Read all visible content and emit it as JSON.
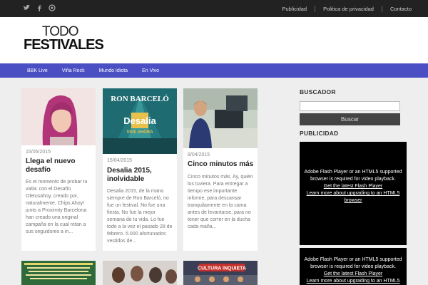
{
  "topbar": {
    "social_icons": [
      "twitter-icon",
      "facebook-icon",
      "globe-icon"
    ],
    "links": [
      "Publicidad",
      "Politica de privacidad",
      "Contacto"
    ]
  },
  "logo": {
    "line1": "TODO",
    "line2": "FESTIVALES"
  },
  "nav": {
    "items": [
      "BBK Live",
      "Viña Rock",
      "Mundo Idiota",
      "En Vivo"
    ]
  },
  "posts": [
    {
      "date": "15/05/2015",
      "title": "Llega el nuevo desafío",
      "excerpt": "Es el momento de probar tu valía: con el Desafío Oletusahoy, creado por, naturalmente, Chips Ahoy! junto a Proximity Barcelona han creado una original campaña en la cual retan a sus seguidores a in..."
    },
    {
      "date": "15/04/2015",
      "title": "Desalia 2015, inolvidable",
      "image_text": [
        "RON BARCELÓ",
        "Desalia",
        "VIVE AHORA"
      ],
      "excerpt": "Desalia 2015, de la mano siempre de Ron Barceló, no fue un festival. No fue una fiesta. No fue la mejor semana de tu vida. Lo fue todo a la vez el pasado 28 de febrero. 5.000 afortunados vestidos de..."
    },
    {
      "date": "8/04/2015",
      "title": "Cinco minutos más",
      "excerpt": "Cinco minutos más. Ay, quién los tuviera. Para entregar a tiempo ese importante informe, para descansar tranquilamente en la cama antes de levantarse, para no tener que correr en la ducha cada maña..."
    }
  ],
  "bottom_images": [
    {
      "caption": ""
    },
    {
      "caption": ""
    },
    {
      "caption": "CULTURA INQUIETA"
    }
  ],
  "sidebar": {
    "search_heading": "BUSCADOR",
    "search_value": "",
    "search_button": "Buscar",
    "ad_heading": "PUBLICIDAD",
    "flash_lines": [
      "Adobe Flash Player or an HTML5 supported browser is required for video playback.",
      "Get the latest Flash Player",
      "Learn more about upgrading to an HTML5 browser"
    ]
  },
  "colors": {
    "topbar": "#222222",
    "nav": "#4a4fc4",
    "search_button": "#444444"
  }
}
